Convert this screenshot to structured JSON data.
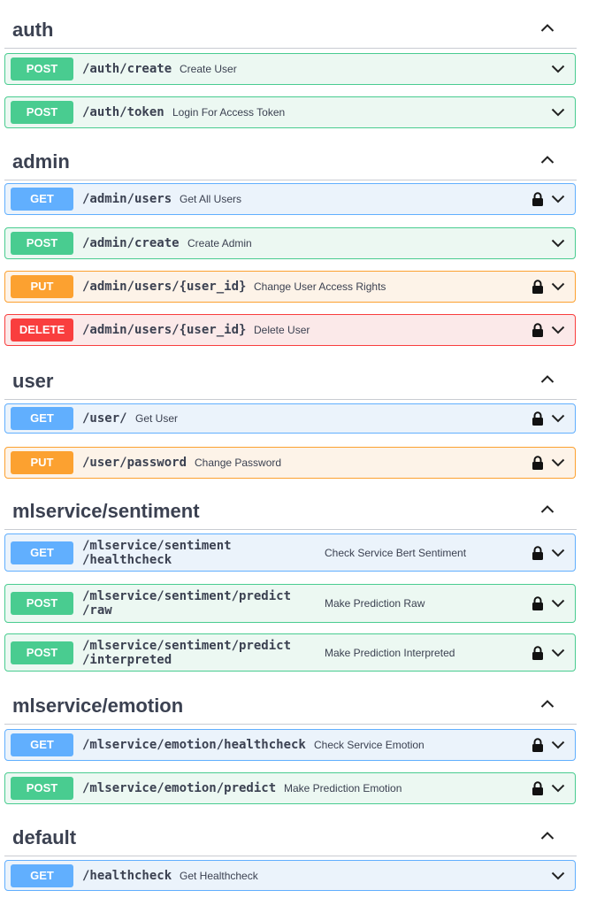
{
  "colors": {
    "post": "#49cc90",
    "get": "#61affe",
    "put": "#fca130",
    "delete": "#f93e3e",
    "text": "#3b4151"
  },
  "sections": [
    {
      "name": "auth",
      "ops": [
        {
          "method": "POST",
          "path": "/auth/create",
          "summary": "Create User",
          "locked": false
        },
        {
          "method": "POST",
          "path": "/auth/token",
          "summary": "Login For Access Token",
          "locked": false
        }
      ]
    },
    {
      "name": "admin",
      "ops": [
        {
          "method": "GET",
          "path": "/admin/users",
          "summary": "Get All Users",
          "locked": true
        },
        {
          "method": "POST",
          "path": "/admin/create",
          "summary": "Create Admin",
          "locked": false
        },
        {
          "method": "PUT",
          "path": "/admin/users/{user_id}",
          "summary": "Change User Access Rights",
          "locked": true
        },
        {
          "method": "DELETE",
          "path": "/admin/users/{user_id}",
          "summary": "Delete User",
          "locked": true
        }
      ]
    },
    {
      "name": "user",
      "ops": [
        {
          "method": "GET",
          "path": "/user/",
          "summary": "Get User",
          "locked": true
        },
        {
          "method": "PUT",
          "path": "/user/password",
          "summary": "Change Password",
          "locked": true
        }
      ]
    },
    {
      "name": "mlservice/sentiment",
      "ops": [
        {
          "method": "GET",
          "path": "/mlservice/sentiment\n/healthcheck",
          "summary": "Check Service Bert Sentiment",
          "locked": true
        },
        {
          "method": "POST",
          "path": "/mlservice/sentiment/predict\n/raw",
          "summary": "Make Prediction Raw",
          "locked": true
        },
        {
          "method": "POST",
          "path": "/mlservice/sentiment/predict\n/interpreted",
          "summary": "Make Prediction Interpreted",
          "locked": true
        }
      ]
    },
    {
      "name": "mlservice/emotion",
      "ops": [
        {
          "method": "GET",
          "path": "/mlservice/emotion/healthcheck",
          "summary": "Check Service Emotion",
          "locked": true
        },
        {
          "method": "POST",
          "path": "/mlservice/emotion/predict",
          "summary": "Make Prediction Emotion",
          "locked": true
        }
      ]
    },
    {
      "name": "default",
      "ops": [
        {
          "method": "GET",
          "path": "/healthcheck",
          "summary": "Get Healthcheck",
          "locked": false
        }
      ]
    }
  ]
}
